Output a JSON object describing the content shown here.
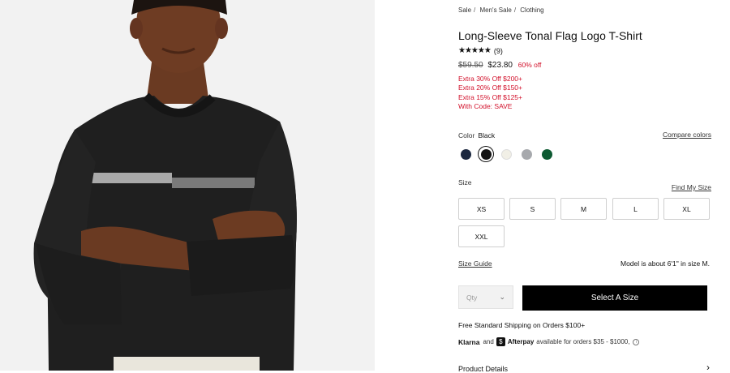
{
  "breadcrumb": [
    "Sale",
    "Men's Sale",
    "Clothing"
  ],
  "breadcrumb_sep": "/",
  "product": {
    "title": "Long-Sleeve Tonal Flag Logo T-Shirt",
    "stars": "★★★★★",
    "review_count": "(9)",
    "rating_value": 5,
    "price_original": "$59.50",
    "price_sale": "$23.80",
    "discount": "60% off",
    "promos": [
      "Extra 30% Off $200+",
      "Extra 20% Off $150+",
      "Extra 15% Off $125+",
      "With Code: SAVE"
    ]
  },
  "color": {
    "label": "Color",
    "selected": "Black",
    "compare_label": "Compare colors",
    "swatches": [
      {
        "name": "navy",
        "hex": "#1c2840"
      },
      {
        "name": "black",
        "hex": "#141414",
        "selected": true
      },
      {
        "name": "cream",
        "hex": "#f1efe6"
      },
      {
        "name": "grey",
        "hex": "#a7a9ad"
      },
      {
        "name": "green",
        "hex": "#0d5a32"
      }
    ]
  },
  "size": {
    "label": "Size",
    "find_label": "Find My Size",
    "options": [
      "XS",
      "S",
      "M",
      "L",
      "XL",
      "XXL"
    ],
    "guide_label": "Size Guide",
    "model_note": "Model is about 6'1\" in size M."
  },
  "purchase": {
    "qty_placeholder": "Qty",
    "cta_label": "Select A Size",
    "shipping": "Free Standard Shipping on Orders $100+",
    "klarna": "Klarna",
    "and": "and",
    "afterpay": "Afterpay",
    "afterpay_icon": "$",
    "installments": "available for orders $35 - $1000,",
    "info_icon": "i"
  },
  "details_label": "Product Details",
  "colors": {
    "sale_red": "#d2102a",
    "cta_black": "#000000"
  }
}
